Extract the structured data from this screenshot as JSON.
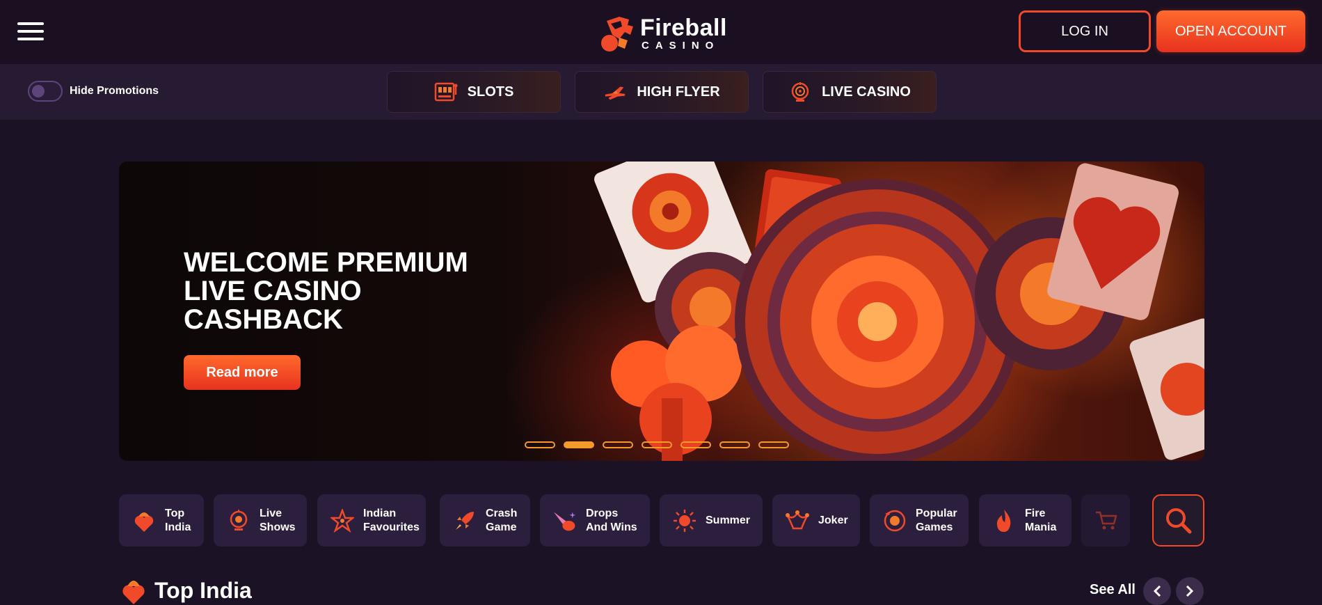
{
  "header": {
    "menu_icon": "hamburger-menu-icon",
    "logo": {
      "word": "Fireball",
      "sub": "CASINO"
    },
    "login_label": "LOG IN",
    "open_account_label": "OPEN ACCOUNT"
  },
  "subnav": {
    "toggle_label": "Hide Promotions",
    "tabs": [
      {
        "label": "SLOTS",
        "icon": "slot-machine-icon"
      },
      {
        "label": "HIGH FLYER",
        "icon": "plane-icon"
      },
      {
        "label": "LIVE CASINO",
        "icon": "roulette-icon"
      }
    ]
  },
  "banner": {
    "title": "WELCOME PREMIUM LIVE CASINO CASHBACK",
    "button_label": "Read more",
    "slides_total": 7,
    "active_slide": 2
  },
  "categories": [
    {
      "label": "Top\nIndia",
      "icon": "heart-turban-icon"
    },
    {
      "label": "Live\nShows",
      "icon": "roulette-icon"
    },
    {
      "label": "Indian\nFavourites",
      "icon": "star-icon"
    },
    {
      "label": "Crash\nGame",
      "icon": "rocket-icon"
    },
    {
      "label": "Drops\nAnd Wins",
      "icon": "comet-icon"
    },
    {
      "label": "Summer",
      "icon": "sun-icon"
    },
    {
      "label": "Joker",
      "icon": "jester-hat-icon"
    },
    {
      "label": "Popular\nGames",
      "icon": "chip-icon"
    },
    {
      "label": "Fire\nMania",
      "icon": "flame-icon"
    },
    {
      "label": "",
      "icon": "cart-icon"
    }
  ],
  "section": {
    "title": "Top India",
    "see_all_label": "See All"
  },
  "colors": {
    "accent": "#f14a2b",
    "accent_gradient_top": "#ff6a2d",
    "background": "#1c1226",
    "tile": "#2c1f3d",
    "dot": "#f39a2a"
  }
}
